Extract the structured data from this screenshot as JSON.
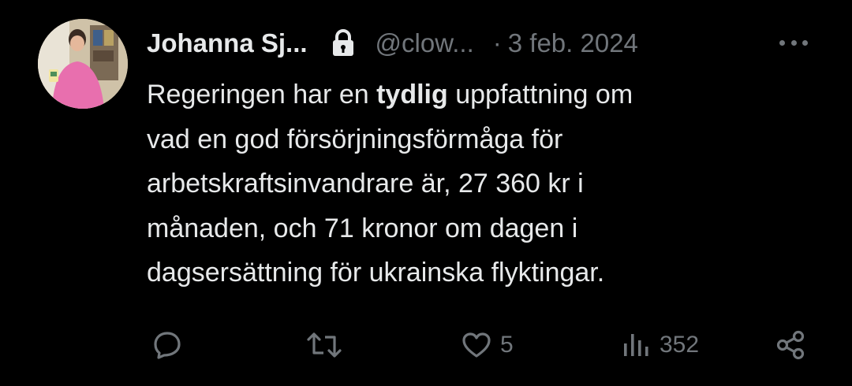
{
  "tweet": {
    "author_name": "Johanna Sj...",
    "handle": "@clow...",
    "separator": "·",
    "date": "3 feb. 2024",
    "text_lines": [
      [
        "Regeringen har en ",
        "tydlig",
        " uppfattning om"
      ],
      [
        "vad en god försörjningsförmåga för"
      ],
      [
        "arbetskraftsinvandrare är, 27 360 kr i"
      ],
      [
        "månaden, och 71 kronor om dagen i"
      ],
      [
        "dagsersättning för ukrainska flyktingar."
      ]
    ]
  },
  "actions": {
    "reply_icon": "reply-icon",
    "retweet_icon": "retweet-icon",
    "like_icon": "heart-icon",
    "like_count": "5",
    "views_icon": "views-icon",
    "views_count": "352",
    "share_icon": "share-icon"
  },
  "colors": {
    "background": "#000000",
    "primary_text": "#e7e9ea",
    "secondary_text": "#71767b"
  }
}
